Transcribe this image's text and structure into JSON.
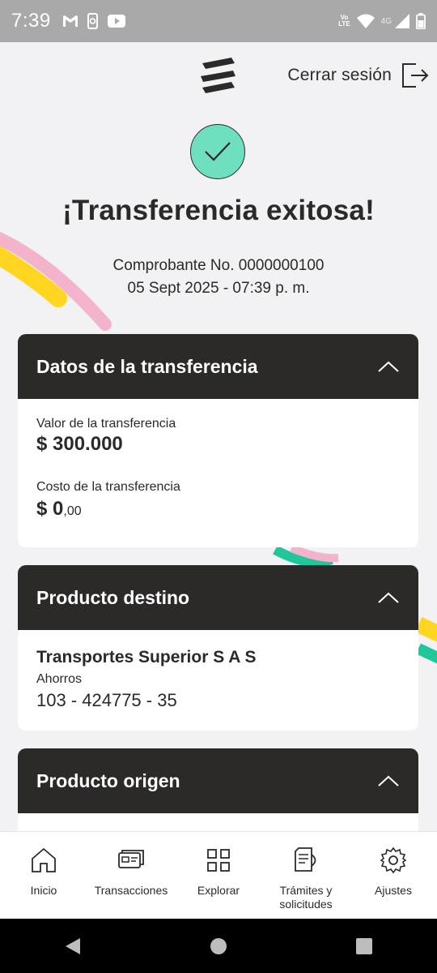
{
  "status_bar": {
    "time": "7:39",
    "left_icons": [
      "gmail-icon",
      "phone-sync-icon",
      "youtube-icon"
    ],
    "volte_top": "Vo",
    "volte_bottom": "LTE",
    "network": "4G",
    "right_icons": [
      "wifi-icon",
      "signal-icon",
      "battery-icon"
    ]
  },
  "header": {
    "logout_label": "Cerrar sesión"
  },
  "success": {
    "title": "¡Transferencia exitosa!",
    "receipt_line": "Comprobante No. 0000000100",
    "datetime": "05 Sept 2025 - 07:39 p. m."
  },
  "transfer_card": {
    "title": "Datos de la transferencia",
    "amount_label": "Valor de la transferencia",
    "amount_value": "$ 300.000",
    "cost_label": "Costo de la transferencia",
    "cost_value": "$ 0",
    "cost_cents": ",00"
  },
  "destination_card": {
    "title": "Producto destino",
    "name": "Transportes Superior S A S",
    "account_type": "Ahorros",
    "account_number": "103 - 424775 - 35"
  },
  "origin_card": {
    "title": "Producto origen"
  },
  "bottom_nav": [
    {
      "label": "Inicio",
      "icon": "home-icon"
    },
    {
      "label": "Transacciones",
      "icon": "transactions-icon"
    },
    {
      "label": "Explorar",
      "icon": "grid-icon"
    },
    {
      "label": "Trámites y solicitudes",
      "icon": "documents-icon"
    },
    {
      "label": "Ajustes",
      "icon": "gear-icon"
    }
  ],
  "colors": {
    "card_header": "#2c2a29",
    "success_green": "#6ee0bf",
    "background": "#f2f2f4",
    "deco_yellow": "#ffd51f",
    "deco_pink": "#f4b3cc",
    "deco_teal": "#1fc79a"
  }
}
